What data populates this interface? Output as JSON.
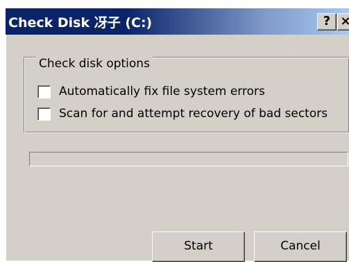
{
  "window": {
    "title": "Check Disk 冴子 (C:)",
    "help_label": "?",
    "close_label": "×"
  },
  "options_group": {
    "legend": "Check disk options",
    "items": [
      {
        "label": "Automatically fix file system errors",
        "checked": false
      },
      {
        "label": "Scan for and attempt recovery of bad sectors",
        "checked": false
      }
    ]
  },
  "progress": {
    "value": 0
  },
  "buttons": {
    "start": "Start",
    "cancel": "Cancel"
  },
  "colors": {
    "title_bar_start": "#0a246a",
    "title_bar_end": "#a6caf0",
    "face": "#d4d0c8"
  }
}
